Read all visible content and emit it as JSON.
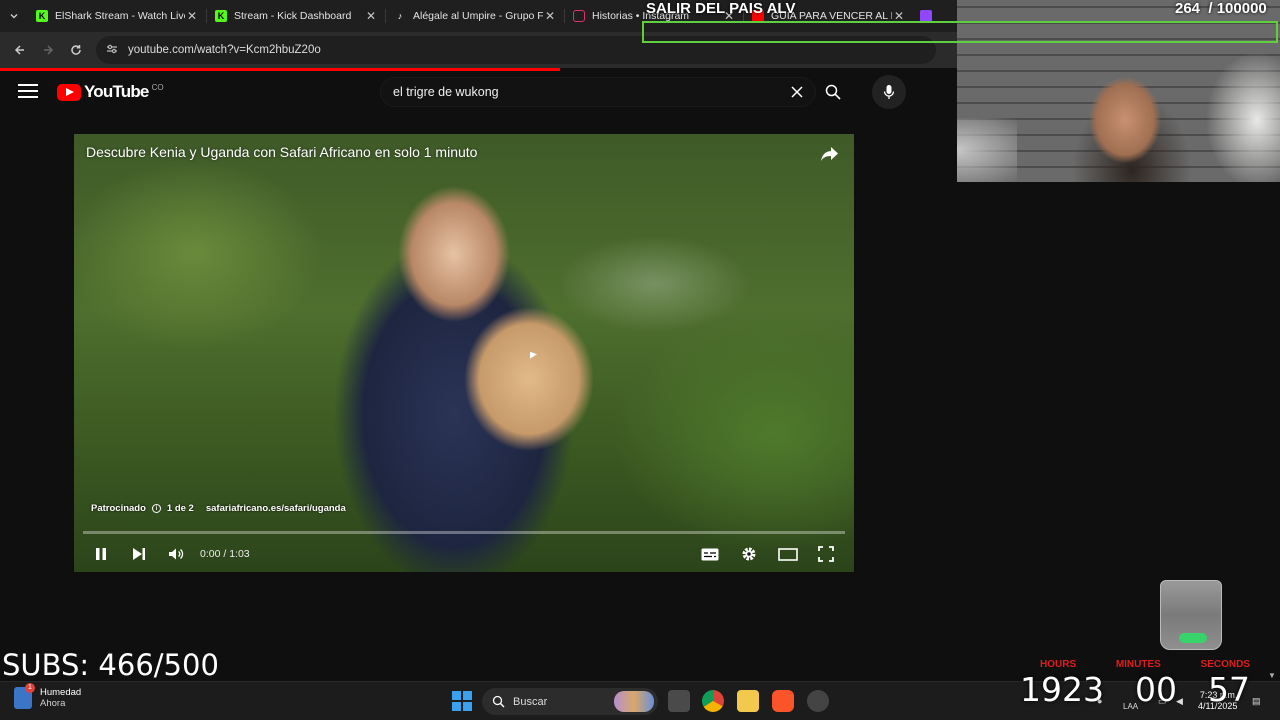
{
  "browser": {
    "tabs": [
      {
        "title": "ElShark Stream - Watch Live",
        "favicon": "kick-icon",
        "color": "#53fc18"
      },
      {
        "title": "Stream - Kick Dashboard",
        "favicon": "kick-icon",
        "color": "#53fc18"
      },
      {
        "title": "Alégale al Umpire - Grupo Fi",
        "favicon": "tiktok-icon",
        "color": "#ffffff"
      },
      {
        "title": "Historias • Instagram",
        "favicon": "instagram-icon",
        "color": "#e1306c"
      },
      {
        "title": "GUIA PARA VENCER AL E",
        "favicon": "youtube-icon",
        "color": "#ff0000"
      }
    ],
    "url": "youtube.com/watch?v=Kcm2hbuZ20o"
  },
  "youtube": {
    "logo_text": "YouTube",
    "country_code": "CO",
    "search_query": "el trigre de wukong"
  },
  "player": {
    "title": "Descubre Kenia y Uganda con Safari Africano en solo 1 minuto",
    "ad_label": "Patrocinado",
    "ad_count": "1 de 2",
    "ad_url": "safariafricano.es/safari/uganda",
    "time": "0:00 / 1:03",
    "progress_fraction": 0
  },
  "overlay": {
    "goal_title": "SALIR DEL PAIS ALV",
    "goal_counter": "264  / 100000",
    "subs": "SUBS: 466/500",
    "timer": {
      "labels": [
        "HOURS",
        "MINUTES",
        "SECONDS"
      ],
      "values": [
        "1923",
        "00",
        "57"
      ]
    }
  },
  "taskbar": {
    "weather_title": "Humedad",
    "weather_sub": "Ahora",
    "search_label": "Buscar",
    "lang": "LAA",
    "time": "7:23 p.m.",
    "date": "4/11/2025"
  },
  "colors": {
    "youtube_red": "#ff0000",
    "goal_green": "#5fcf3d",
    "timer_red": "#e01c1c"
  }
}
